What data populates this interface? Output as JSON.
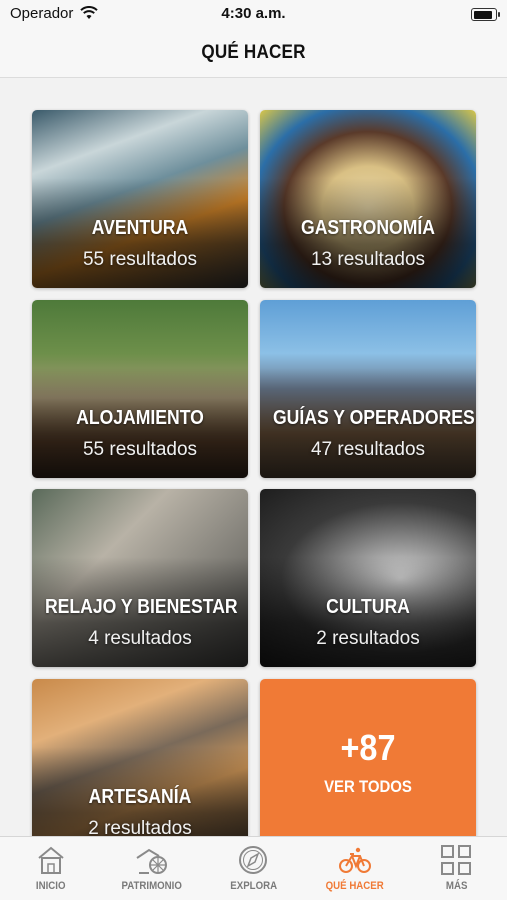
{
  "status_bar": {
    "carrier": "Operador",
    "time": "4:30 a.m."
  },
  "nav": {
    "title": "QUÉ HACER"
  },
  "categories": [
    {
      "title": "AVENTURA",
      "count": "55 resultados"
    },
    {
      "title": "GASTRONOMÍA",
      "count": "13 resultados"
    },
    {
      "title": "ALOJAMIENTO",
      "count": "55 resultados"
    },
    {
      "title": "GUÍAS Y OPERADORES",
      "count": "47 resultados"
    },
    {
      "title": "RELAJO Y BIENESTAR",
      "count": "4 resultados"
    },
    {
      "title": "CULTURA",
      "count": "2 resultados"
    },
    {
      "title": "ARTESANÍA",
      "count": "2 resultados"
    }
  ],
  "more_card": {
    "number": "+87",
    "label": "VER TODOS",
    "color": "#f07a36"
  },
  "tab_bar": {
    "active_color": "#f07a36",
    "inactive_color": "#7a7a7a",
    "tabs": [
      {
        "label": "INICIO",
        "icon": "house-icon"
      },
      {
        "label": "PATRIMONIO",
        "icon": "landmark-icon"
      },
      {
        "label": "EXPLORA",
        "icon": "compass-icon"
      },
      {
        "label": "QUÉ HACER",
        "icon": "bicycle-icon",
        "active": true
      },
      {
        "label": "MÁS",
        "icon": "grid-icon"
      }
    ]
  }
}
